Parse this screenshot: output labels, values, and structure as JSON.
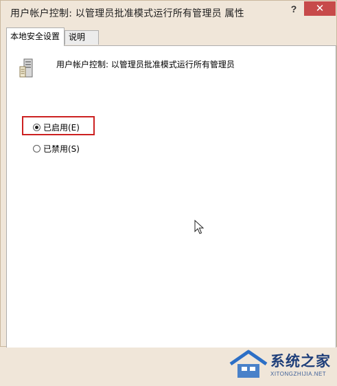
{
  "window": {
    "title": "用户帐户控制: 以管理员批准模式运行所有管理员 属性",
    "help_label": "?",
    "close_label": "✕"
  },
  "tabs": [
    {
      "label": "本地安全设置",
      "active": true
    },
    {
      "label": "说明",
      "active": false
    }
  ],
  "policy": {
    "icon": "server-icon",
    "title": "用户帐户控制: 以管理员批准模式运行所有管理员"
  },
  "options": [
    {
      "label": "已启用(E)",
      "checked": true
    },
    {
      "label": "已禁用(S)",
      "checked": false
    }
  ],
  "watermark": {
    "text": "系统之家",
    "subtext": "XITONGZHIJIA.NET"
  },
  "colors": {
    "highlight": "#cc1f1f",
    "close_button": "#c74a4a",
    "window_bg": "#f0e6d9"
  }
}
